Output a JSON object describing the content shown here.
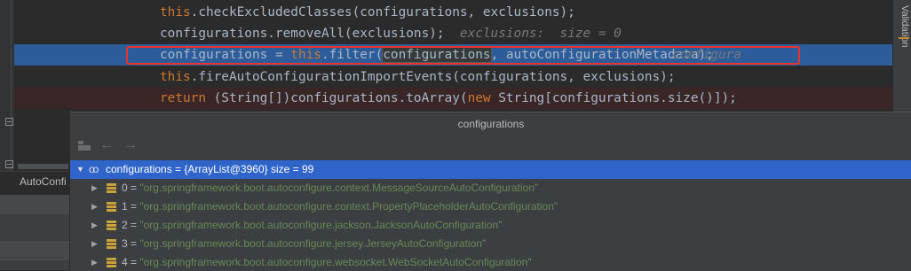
{
  "editor": {
    "lines": [
      {
        "kind": "normal",
        "text": "this.checkExcludedClasses(configurations, exclusions);"
      },
      {
        "kind": "normal",
        "prefix": "configurations.removeAll(exclusions);",
        "hint": "exclusions:  size = 0"
      },
      {
        "kind": "selected",
        "p1": "configurations = ",
        "kw": "this",
        "p2": ".filter(",
        "hl": "configurations",
        "p3": ", autoConfigurationMetadata);",
        "inline": "configura"
      },
      {
        "kind": "normal",
        "kw": "this",
        "p2": ".fireAutoConfigurationImportEvents(configurations, exclusions);"
      },
      {
        "kind": "error",
        "kw": "return",
        "p2": " (String[])configurations.toArray(",
        "kw2": "new",
        "p3": " String[configurations.size()]);"
      }
    ],
    "validation_label": "Validation",
    "left_tab": "AutoConfi"
  },
  "popup": {
    "title": "configurations",
    "toolbar": {
      "back": "←",
      "forward": "→"
    },
    "root": {
      "expander": "▼",
      "name": "configurations",
      "value": " = {ArrayList@3960}  size = 99"
    },
    "items": [
      {
        "index": "0",
        "value": "\"org.springframework.boot.autoconfigure.context.MessageSourceAutoConfiguration\""
      },
      {
        "index": "1",
        "value": "\"org.springframework.boot.autoconfigure.context.PropertyPlaceholderAutoConfiguration\""
      },
      {
        "index": "2",
        "value": "\"org.springframework.boot.autoconfigure.jackson.JacksonAutoConfiguration\""
      },
      {
        "index": "3",
        "value": "\"org.springframework.boot.autoconfigure.jersey.JerseyAutoConfiguration\""
      },
      {
        "index": "4",
        "value": "\"org.springframework.boot.autoconfigure.websocket.WebSocketAutoConfiguration\""
      }
    ],
    "collapsed_arrow": "▶",
    "eq": " = "
  },
  "colors": {
    "keyword": "#cc7832",
    "selection": "#2d5c9a",
    "tree_selection": "#2f65ca",
    "string": "#6a8759",
    "highlight_box": "#e8322d"
  }
}
